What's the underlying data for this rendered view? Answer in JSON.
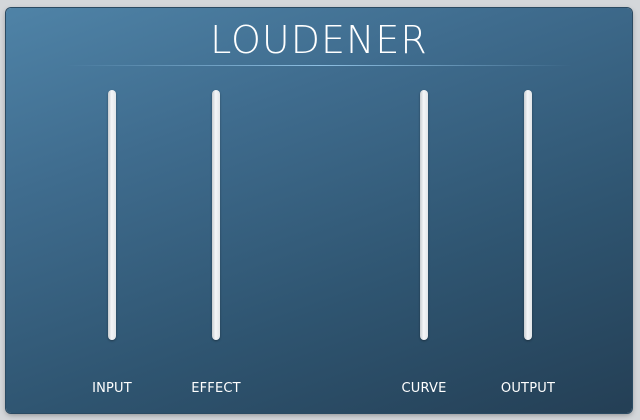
{
  "title": "LOUDENER",
  "sliders": [
    {
      "id": "input",
      "label": "INPUT"
    },
    {
      "id": "effect",
      "label": "EFFECT"
    },
    {
      "id": "curve",
      "label": "CURVE"
    },
    {
      "id": "output",
      "label": "OUTPUT"
    }
  ],
  "colors": {
    "panel_top": "#4f83a7",
    "panel_bottom": "#243f55",
    "track": "#eceef0",
    "text": "#ffffff"
  }
}
